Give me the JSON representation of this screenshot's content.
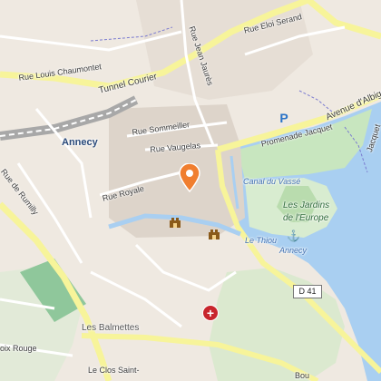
{
  "map": {
    "city_label": "Annecy",
    "streets": {
      "tunnel": "Tunnel Courier",
      "chaumontet": "Rue Louis Chaumontet",
      "sommeiller": "Rue Sommeiller",
      "vaugelas": "Rue Vaugelas",
      "royale": "Rue Royale",
      "rumilly": "Rue de Rumilly",
      "jaures": "Rue Jean Jaurès",
      "serand": "Rue Eloi Serand",
      "promenade": "Promenade Jacquet",
      "albigny": "Avenue d'Albigny",
      "jacquet": "Jacquet",
      "clos": "Le Clos Saint-",
      "croix": "oix Rouge",
      "bou": "Bou"
    },
    "areas": {
      "jardins": "Les Jardins de l'Europe",
      "balmettes": "Les Balmettes"
    },
    "water": {
      "canal": "Canal du Vassé",
      "thiou": "Le Thiou",
      "annecy_lake": "Annecy"
    },
    "road_shield": "D 41",
    "icons": {
      "marker": "location-pin-icon",
      "hospital": "hospital-icon",
      "parking": "parking-icon",
      "monument": "monument-icon",
      "harbour": "anchor-icon"
    },
    "parking_letter": "P",
    "hospital_symbol": "+",
    "colors": {
      "lake": "#a9cff1",
      "park": "#c8e6bf",
      "main_road": "#f7f49a",
      "marker": "#f07e2f",
      "hospital": "#c8252c"
    }
  }
}
